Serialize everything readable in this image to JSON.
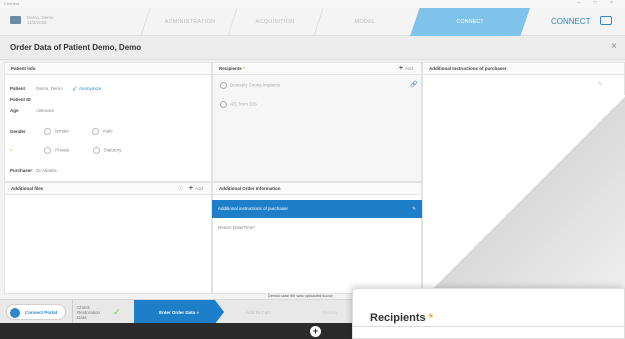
{
  "window": {
    "title": "Connect"
  },
  "header": {
    "patient_name": "Demo, Demo",
    "patient_sub": "11/2/2018",
    "steps": [
      "ADMINISTRATION",
      "ACQUISITION",
      "MODEL"
    ],
    "active_step": "CONNECT",
    "brand": "CONNECT"
  },
  "page": {
    "title": "Order Data of Patient Demo, Demo"
  },
  "patient_info": {
    "heading": "Patient info",
    "patient_label": "Patient",
    "patient_value": "Demo, Demo",
    "anonymize_label": "Anonymize",
    "patient_id_label": "Patient ID",
    "age_label": "Age",
    "age_value": "unknown",
    "gender_label": "Gender",
    "female": "female",
    "male": "male",
    "private": "Private",
    "statutory": "Statutory",
    "purchaser_label": "Purchaser",
    "purchaser_value": "Dr Atlantis"
  },
  "additional_files": {
    "heading": "Additional files",
    "add": "Add"
  },
  "recipients": {
    "heading": "Recipients",
    "add": "Add",
    "items": [
      "Dentsply Sirona Implants",
      "ATL from DIS"
    ]
  },
  "additional_order": {
    "heading": "Additional Order Information",
    "selected": "Additional instructions of purchaser",
    "return_label": "Return Date/Time*"
  },
  "instructions": {
    "heading": "Additional instructions of purchaser"
  },
  "notice": "Dental case file was uploaded succe",
  "footer": {
    "connect_portal": "Connect Portal",
    "check_step": "Check Restoration Data",
    "active": "Enter Order Data »",
    "next1": "Add To Cart",
    "next2": "Submit"
  },
  "overlay": {
    "title": "Recipients"
  },
  "colors": {
    "accent": "#1e7fc9",
    "star": "#f3a31b",
    "check": "#7ac943"
  }
}
